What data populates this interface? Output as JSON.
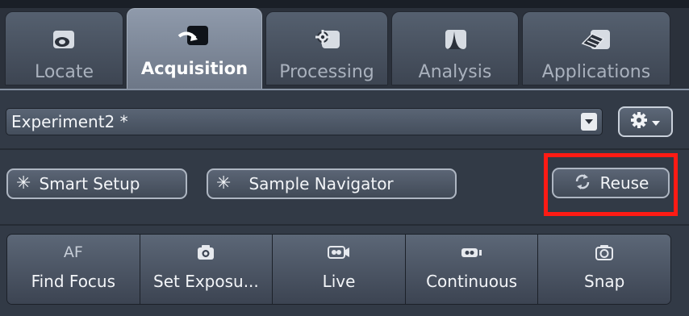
{
  "tabs": [
    {
      "label": "Locate",
      "icon": "locate-icon",
      "active": false
    },
    {
      "label": "Acquisition",
      "icon": "acquisition-icon",
      "active": true
    },
    {
      "label": "Processing",
      "icon": "processing-gear-icon",
      "active": false
    },
    {
      "label": "Analysis",
      "icon": "analysis-peak-icon",
      "active": false
    },
    {
      "label": "Applications",
      "icon": "applications-icon",
      "active": false
    }
  ],
  "experiment": {
    "selected": "Experiment2 *",
    "gear_menu_icon": "gear-icon"
  },
  "tools": {
    "smart_setup": "Smart Setup",
    "sample_navigator": "Sample Navigator",
    "reuse": "Reuse"
  },
  "actions": [
    {
      "label": "Find Focus",
      "icon_text": "AF",
      "icon": "af-icon"
    },
    {
      "label": "Set Exposu...",
      "icon": "camera-icon"
    },
    {
      "label": "Live",
      "icon": "live-video-icon"
    },
    {
      "label": "Continuous",
      "icon": "continuous-video-icon"
    },
    {
      "label": "Snap",
      "icon": "snap-camera-icon"
    }
  ],
  "colors": {
    "highlight": "#ff1b14",
    "panel_bg": "#323a46",
    "active_tab": "#8f9aab"
  }
}
